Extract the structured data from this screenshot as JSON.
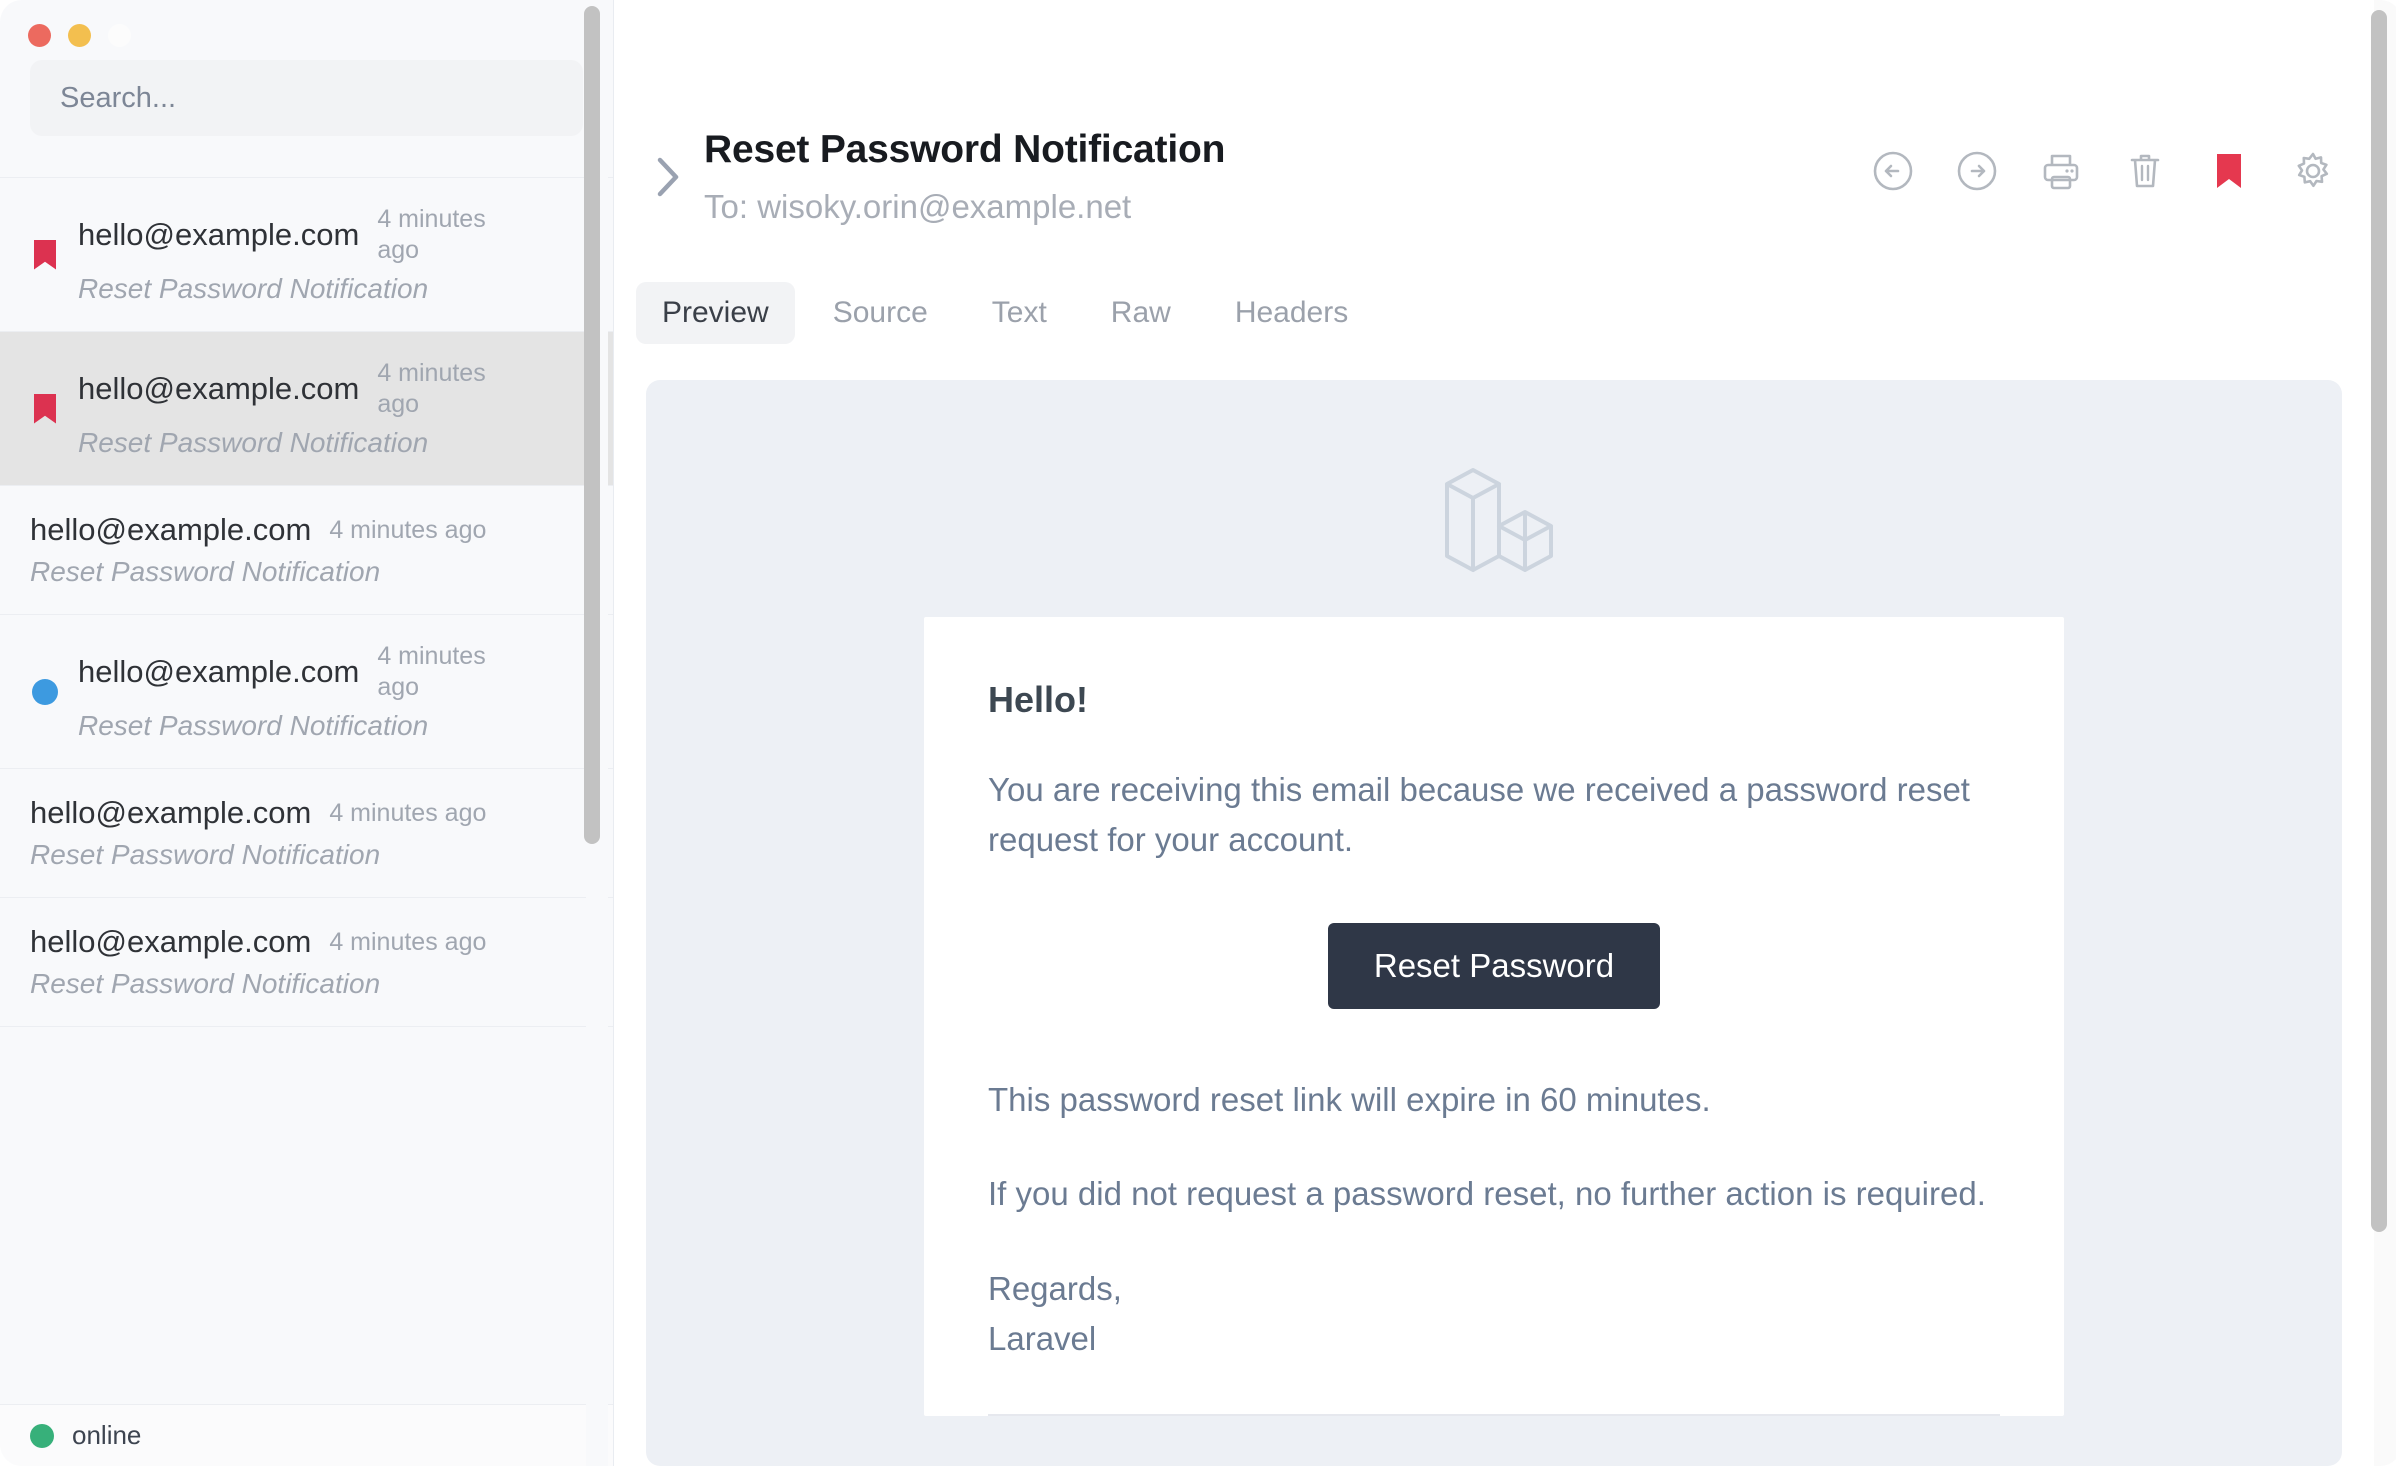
{
  "window": {
    "traffic_lights": [
      "close-red",
      "minimize-yellow",
      "zoom-inactive"
    ]
  },
  "sidebar": {
    "search": {
      "placeholder": "Search...",
      "value": ""
    },
    "messages": [
      {
        "from": "hello@example.com",
        "time": "4 minutes ago",
        "subject": "Reset Password Notification",
        "badge": "bookmark",
        "selected": false
      },
      {
        "from": "hello@example.com",
        "time": "4 minutes ago",
        "subject": "Reset Password Notification",
        "badge": "bookmark",
        "selected": true
      },
      {
        "from": "hello@example.com",
        "time": "4 minutes ago",
        "subject": "Reset Password Notification",
        "badge": "none",
        "selected": false
      },
      {
        "from": "hello@example.com",
        "time": "4 minutes ago",
        "subject": "Reset Password Notification",
        "badge": "dot",
        "selected": false
      },
      {
        "from": "hello@example.com",
        "time": "4 minutes ago",
        "subject": "Reset Password Notification",
        "badge": "none",
        "selected": false
      },
      {
        "from": "hello@example.com",
        "time": "4 minutes ago",
        "subject": "Reset Password Notification",
        "badge": "none",
        "selected": false
      }
    ],
    "status": {
      "label": "online",
      "color": "#37b07a"
    }
  },
  "header": {
    "expand_icon": "chevron-right-icon",
    "title": "Reset Password Notification",
    "recipient": "To: wisoky.orin@example.net",
    "toolbar": [
      {
        "name": "previous-button",
        "icon": "arrow-left-circle-icon",
        "color": "#b3b8bf"
      },
      {
        "name": "next-button",
        "icon": "arrow-right-circle-icon",
        "color": "#b3b8bf"
      },
      {
        "name": "print-button",
        "icon": "printer-icon",
        "color": "#b3b8bf"
      },
      {
        "name": "delete-button",
        "icon": "trash-icon",
        "color": "#b3b8bf"
      },
      {
        "name": "bookmark-button",
        "icon": "bookmark-filled-icon",
        "color": "#e5384f"
      },
      {
        "name": "settings-button",
        "icon": "gear-icon",
        "color": "#b3b8bf"
      }
    ]
  },
  "tabs": [
    {
      "label": "Preview",
      "active": true
    },
    {
      "label": "Source",
      "active": false
    },
    {
      "label": "Text",
      "active": false
    },
    {
      "label": "Raw",
      "active": false
    },
    {
      "label": "Headers",
      "active": false
    }
  ],
  "email": {
    "logo": "laravel-logo-icon",
    "greeting": "Hello!",
    "intro": "You are receiving this email because we received a password reset request for your account.",
    "cta_label": "Reset Password",
    "expiry": "This password reset link will expire in 60 minutes.",
    "no_action": "If you did not request a password reset, no further action is required.",
    "regards": "Regards,",
    "signature": "Laravel"
  },
  "colors": {
    "accent_red": "#dc3250",
    "accent_blue": "#3d9ae0",
    "accent_green": "#37b07a",
    "button_dark": "#2f3747",
    "preview_bg": "#edf0f5"
  }
}
